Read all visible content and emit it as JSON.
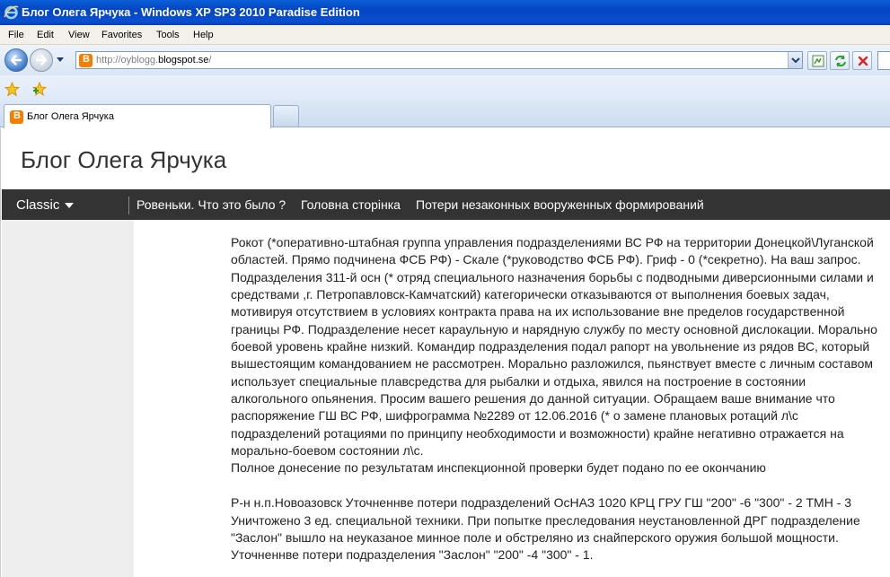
{
  "window": {
    "title": "Блог Олега Ярчука - Windows XP SP3 2010 Paradise Edition"
  },
  "menu": [
    "File",
    "Edit",
    "View",
    "Favorites",
    "Tools",
    "Help"
  ],
  "address_bar": {
    "url_prefix": "http://oyblogg.",
    "url_domain": "blogspot.se",
    "url_suffix": "/"
  },
  "tabs": [
    {
      "label": "Блог Олега Ярчука"
    }
  ],
  "blog": {
    "title": "Блог Олега Ярчука",
    "nav_view": "Classic",
    "nav_links": [
      "Ровеньки. Что это было ?",
      "Головна сторінка",
      "Потери незаконных вооруженных формирований"
    ]
  },
  "article": {
    "lines": [
      "Рокот (*оперативно-штабная группа управления подразделениями ВС РФ на территории Донецкой\\Луганской",
      "областей. Прямо подчинена ФСБ РФ) - Скале (*руководство ФСБ РФ). Гриф - 0 (*секретно). На ваш запрос.",
      "Подразделения 311-й осн (* отряд специального назначения борьбы с подводными диверсионными силами и",
      "средствами ,г. Петропавловск-Камчатский)  категорически отказываются от выполнения боевых задач,",
      "мотивируя отсутствием в условиях контракта права на их использование вне пределов государственной",
      "границы РФ.  Подразделение несет караульную и нарядную службу по месту основной дислокации. Морально",
      "боевой уровень крайне низкий. Командир подразделения подал рапорт на увольнение из рядов ВС, который",
      "вышестоящим командованием не рассмотрен.  Морально разложился, пьянствует вместе с личным составом",
      "использует специальные плавсредства для рыбалки и отдыха, явился на построение в состоянии",
      "алкогольного опьянения. Просим вашего решения до данной ситуации. Обращаем ваше внимание что",
      "распоряжение ГШ ВС РФ, шифрограмма  №2289 от 12.06.2016 (* о замене плановых ротаций л\\с",
      "подразделений ротациями по принципу необходимости и возможности) крайне негативно отражается на",
      "морально-боевом состоянии л\\с.",
      "Полное донесение по результатам инспекционной проверки будет подано по ее окончанию",
      "",
      "Р-н н.п.Новоазовск Уточненнве потери  подразделений ОсНАЗ 1020 КРЦ ГРУ ГШ  \"200\" -6 \"300\" - 2 ТМН - 3",
      "Уничтожено 3 ед. специальной техники. При попытке преследования неустановленной ДРГ подразделение",
      "\"Заслон\" вышло на неуказаное  минное поле и обстреляно из снайперского оружия большой мощности.",
      "Уточненнве потери подразделения \"Заслон\"   \"200\" -4 \"300\" - 1."
    ]
  },
  "icons": {
    "back": "back-arrow-icon",
    "forward": "forward-arrow-icon",
    "refresh": "refresh-icon",
    "stop": "stop-icon",
    "compat": "compatibility-view-icon",
    "favorites": "favorites-star-icon",
    "add_favorites": "add-to-favorites-icon"
  },
  "colors": {
    "titlebar": "#0a5fd8",
    "blog_nav_bg": "#333333",
    "blogger_orange": "#f57d00"
  }
}
